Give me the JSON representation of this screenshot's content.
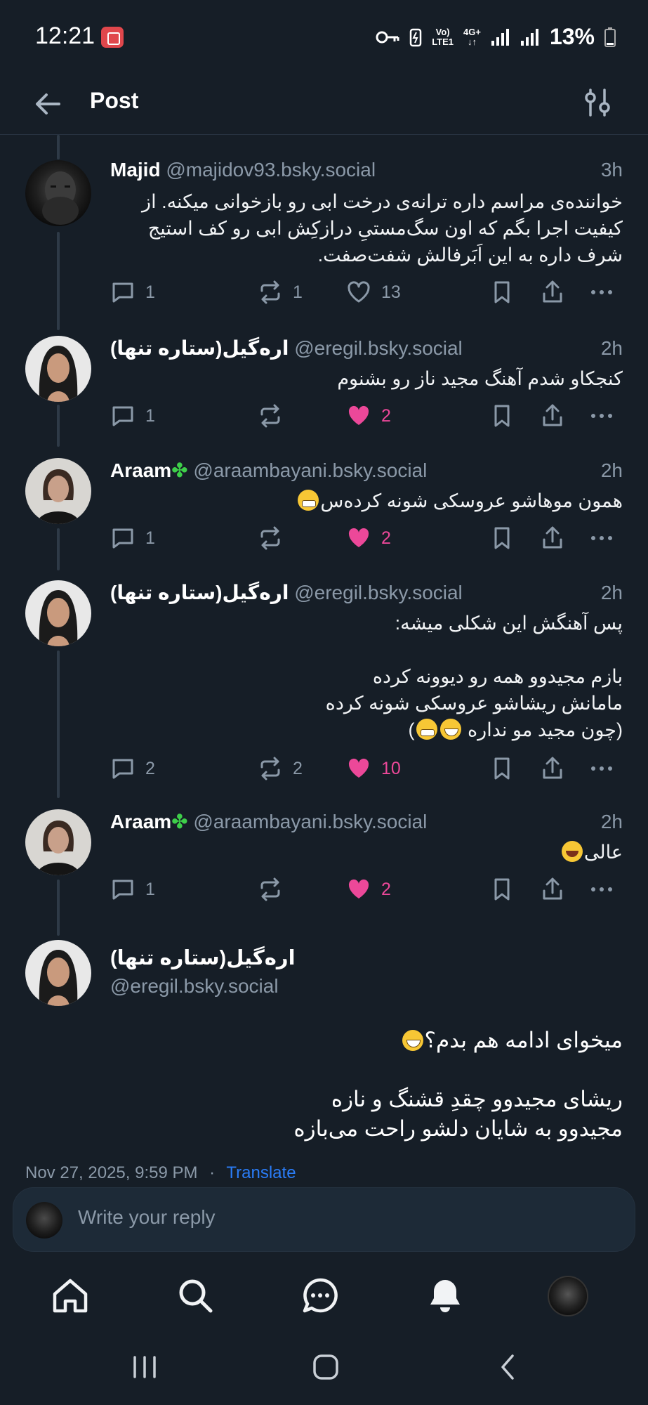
{
  "status": {
    "time": "12:21",
    "network1": "Vo)",
    "network2": "LTE1",
    "network3": "4G+",
    "battery": "13%"
  },
  "header": {
    "title": "Post"
  },
  "posts": [
    {
      "name": "Majid",
      "handle": "@majidov93.bsky.social",
      "time": "3h",
      "text": "خواننده‌ی مراسم داره ترانه‌ی درخت ابی رو بازخوانی میکنه. از کیفیت اجرا بگم که اون سگ‌مستیِ درازکِش ابی رو کف استیج شرف داره به این اَبَرفالش شفت‌صفت.",
      "replies": "1",
      "reposts": "1",
      "likes": "13"
    },
    {
      "name": "اره‌گیل(ستاره تنها)",
      "handle": "@eregil.bsky.social",
      "time": "2h",
      "text": "کنجکاو شدم آهنگ مجید ناز رو بشنوم",
      "replies": "1",
      "reposts": "",
      "likes": "2"
    },
    {
      "name": "Araam",
      "handle": "@araambayani.bsky.social",
      "time": "2h",
      "text": "همون موهاشو عروسکی شونه کرده‌س",
      "replies": "1",
      "reposts": "",
      "likes": "2"
    },
    {
      "name": "اره‌گیل(ستاره تنها)",
      "handle": "@eregil.bsky.social",
      "time": "2h",
      "line1": "پس آهنگش این شکلی میشه:",
      "line2": "بازم مجیدوو همه رو دیوونه کرده",
      "line3": "مامانش ریشاشو عروسکی شونه کرده",
      "line4": "(چون مجید مو نداره",
      "replies": "2",
      "reposts": "2",
      "likes": "10"
    },
    {
      "name": "Araam",
      "handle": "@araambayani.bsky.social",
      "time": "2h",
      "text": "عالی",
      "replies": "1",
      "reposts": "",
      "likes": "2"
    }
  ],
  "main_post": {
    "name": "اره‌گیل(ستاره تنها)",
    "handle": "@eregil.bsky.social",
    "line1": "میخوای ادامه هم بدم؟",
    "line2": "ریشای مجیدوو چقدِ قشنگ و نازه",
    "line3": "مجیدوو به شایان دلشو راحت می‌بازه",
    "date": "Nov 27, 2025, 9:59 PM",
    "separator": "·",
    "translate": "Translate"
  },
  "reply_box": {
    "placeholder": "Write your reply"
  },
  "colors": {
    "background": "#161e27",
    "like": "#ec4899",
    "link": "#2a7cf6",
    "muted": "#8b99a8"
  }
}
